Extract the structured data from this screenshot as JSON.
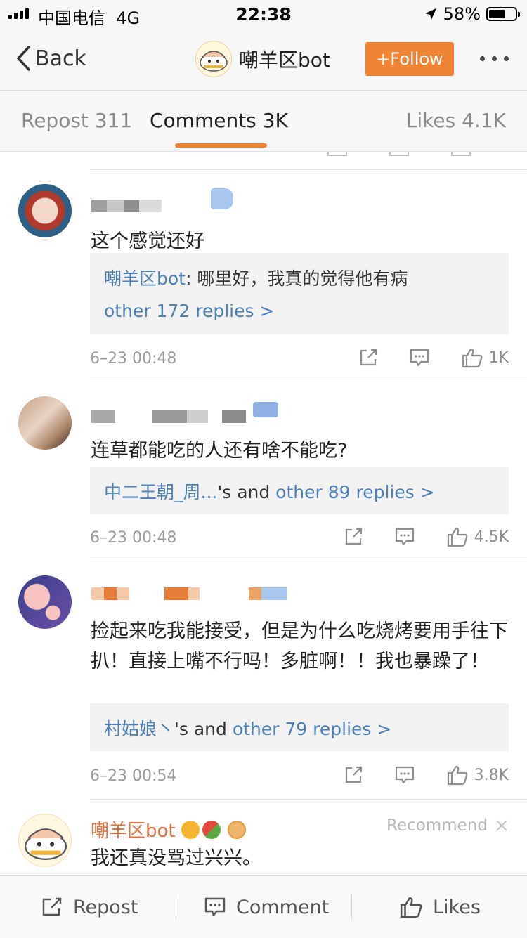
{
  "status_bar": {
    "carrier": "中国电信",
    "network": "4G",
    "time": "22:38",
    "battery": "58%",
    "battery_level": 0.58
  },
  "nav": {
    "back_label": "Back",
    "title": "嘲羊区bot",
    "follow_label": "+Follow"
  },
  "tabs": [
    {
      "label": "Repost 311"
    },
    {
      "label": "Comments 3K"
    },
    {
      "label": "Likes 4.1K"
    }
  ],
  "comments": [
    {
      "text": "这个感觉还好",
      "reply_author": "嘲羊区bot",
      "reply_text": ": 哪里好，我真的觉得他有病",
      "reply_more": "other 172 replies >",
      "time": "6–23 00:48",
      "likes": "1K"
    },
    {
      "text": "连草都能吃的人还有啥不能吃?",
      "reply_author": "中二王朝_周...",
      "reply_connector": "'s and ",
      "reply_more": "other 89 replies >",
      "time": "6–23 00:48",
      "likes": "4.5K"
    },
    {
      "text": "捡起来吃我能接受，但是为什么吃烧烤要用手往下扒！直接上嘴不行吗！多脏啊！！我也暴躁了！",
      "reply_author": "村姑娘丶",
      "reply_connector": "'s and ",
      "reply_more": "other 79 replies >",
      "time": "6–23 00:54",
      "likes": "3.8K"
    },
    {
      "author": "嘲羊区bot",
      "recommend_label": "Recommend",
      "text": "我还真没骂过兴兴。"
    }
  ],
  "bottom_bar": {
    "repost_label": "Repost",
    "comment_label": "Comment",
    "likes_label": "Likes"
  },
  "colors": {
    "accent": "#f08434",
    "link": "#4d7fb8",
    "owner_name": "#e0703c"
  }
}
